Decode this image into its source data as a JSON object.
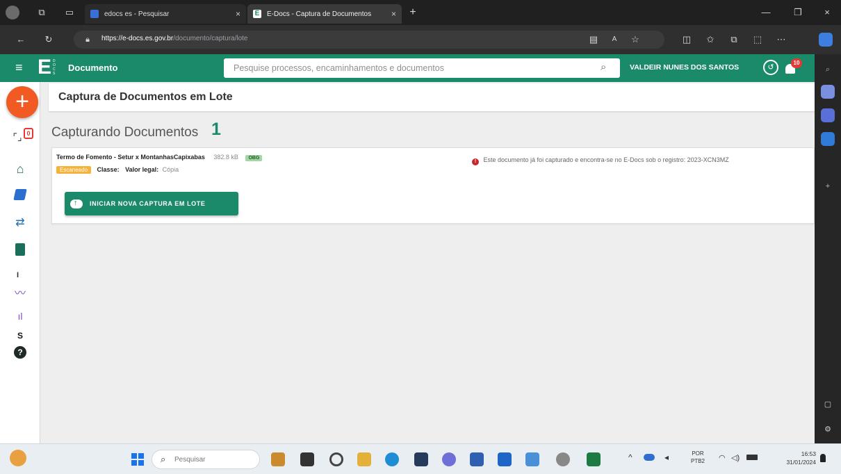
{
  "browser": {
    "tabs": [
      {
        "label": "edocs es - Pesquisar",
        "active": false
      },
      {
        "label": "E-Docs - Captura de Documentos",
        "active": true
      }
    ],
    "url_host": "https://e-docs.es.gov.br",
    "url_path": "/documento/captura/lote",
    "new_tab": "+",
    "close_glyph": "×"
  },
  "app": {
    "logo_letter": "E",
    "logo_sub": "DOCS",
    "module": "Documento",
    "search_placeholder": "Pesquise processos, encaminhamentos e documentos",
    "user_name": "VALDEIR NUNES DOS SANTOS",
    "notification_count": "10",
    "capture_badge": "0",
    "brand_color": "#1b8a6b",
    "fab_color": "#f25a24"
  },
  "page": {
    "title": "Captura de Documentos em Lote",
    "section_title": "Capturando Documentos",
    "section_count": "1"
  },
  "document": {
    "name": "Termo de Fomento - Setur x MontanhasCapixabas",
    "size": "382.8 kB",
    "tag": "OBG",
    "status_badge": "Escaneado",
    "classe_label": "Classe:",
    "valor_label": "Valor legal:",
    "valor_value": "Cópia",
    "error_message": "Este documento já foi capturado e encontra-se no E-Docs sob o registro: 2023-XCN3MZ"
  },
  "actions": {
    "new_batch_button": "INICIAR NOVA CAPTURA EM LOTE"
  },
  "sidebar": {
    "divider_label_1": "I",
    "divider_label_2": "S"
  },
  "taskbar": {
    "search_placeholder": "Pesquisar",
    "lang_top": "POR",
    "lang_bottom": "PTB2",
    "time": "16:53",
    "date": "31/01/2024"
  }
}
